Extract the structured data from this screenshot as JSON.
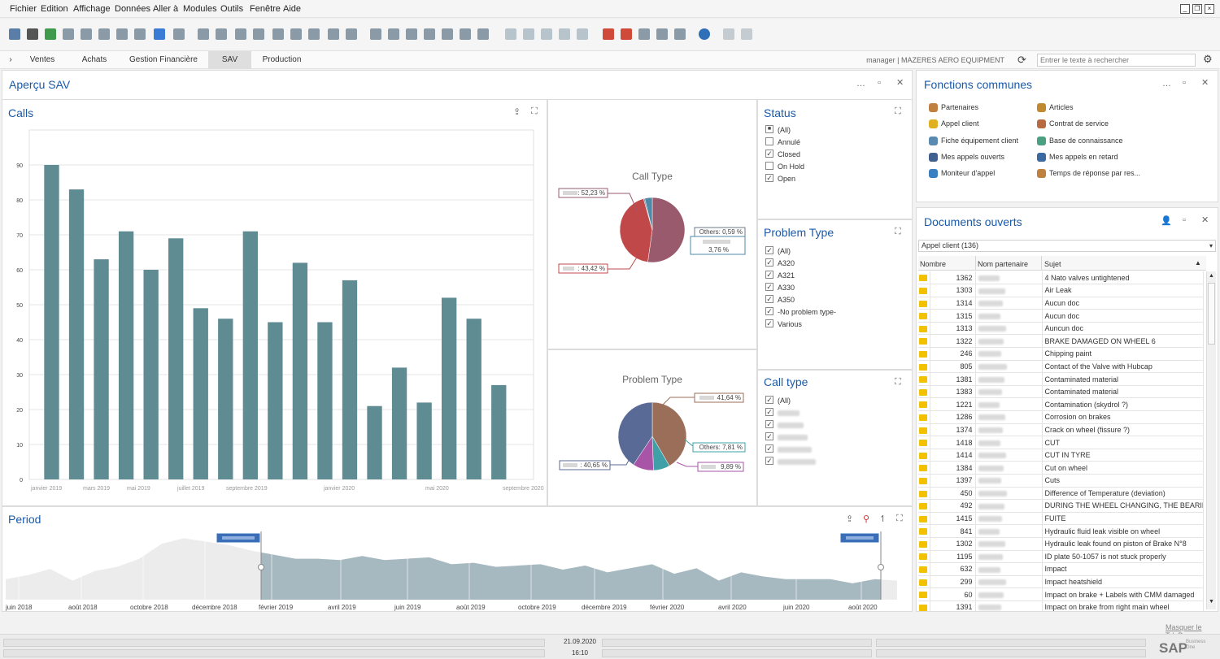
{
  "menu": [
    "Fichier",
    "Edition",
    "Affichage",
    "Données",
    "Aller à",
    "Modules",
    "Outils",
    "Fenêtre",
    "Aide"
  ],
  "modules": {
    "chevron": "›",
    "tabs": [
      "Ventes",
      "Achats",
      "Gestion Financière",
      "SAV",
      "Production"
    ],
    "active": "SAV"
  },
  "header": {
    "user": "manager | MAZERES AERO EQUIPMENT",
    "search_placeholder": "Entrer le texte à rechercher"
  },
  "overview": {
    "title": "Aperçu SAV"
  },
  "calls": {
    "title": "Calls"
  },
  "call_type_pie": {
    "title": "Call Type",
    "labels": [
      ": 52,23 %",
      ": 43,42 %",
      "Others: 0,59 %",
      "3,76 %"
    ]
  },
  "problem_type_pie": {
    "title": "Problem Type",
    "labels": [
      "41,64 %",
      "Others: 7,81 %",
      "9,89 %",
      ": 40,65 %"
    ]
  },
  "status": {
    "title": "Status",
    "items": [
      {
        "label": "(All)",
        "state": "partial"
      },
      {
        "label": "Annulé",
        "state": "off"
      },
      {
        "label": "Closed",
        "state": "on"
      },
      {
        "label": "On Hold",
        "state": "off"
      },
      {
        "label": "Open",
        "state": "on"
      }
    ]
  },
  "problem_type": {
    "title": "Problem Type",
    "items": [
      {
        "label": "(All)",
        "state": "on"
      },
      {
        "label": "A320",
        "state": "on"
      },
      {
        "label": "A321",
        "state": "on"
      },
      {
        "label": "A330",
        "state": "on"
      },
      {
        "label": "A350",
        "state": "on"
      },
      {
        "label": "-No problem type-",
        "state": "on"
      },
      {
        "label": "Various",
        "state": "on"
      }
    ]
  },
  "call_type": {
    "title": "Call type",
    "items": [
      {
        "label": "(All)",
        "state": "on"
      },
      {
        "label": "",
        "state": "on"
      },
      {
        "label": "",
        "state": "on"
      },
      {
        "label": "",
        "state": "on"
      },
      {
        "label": "",
        "state": "on"
      },
      {
        "label": "",
        "state": "on"
      }
    ]
  },
  "period": {
    "title": "Period",
    "ticks": [
      "juin 2018",
      "août 2018",
      "octobre 2018",
      "décembre 2018",
      "février 2019",
      "avril 2019",
      "juin 2019",
      "août 2019",
      "octobre 2019",
      "décembre 2019",
      "février 2020",
      "avril 2020",
      "juin 2020",
      "août 2020"
    ]
  },
  "fonctions": {
    "title": "Fonctions communes",
    "left": [
      "Partenaires",
      "Appel client",
      "Fiche équipement client",
      "Mes appels ouverts",
      "Moniteur d'appel"
    ],
    "right": [
      "Articles",
      "Contrat de service",
      "Base de connaissance",
      "Mes appels en retard",
      "Temps de réponse par res..."
    ]
  },
  "documents": {
    "title": "Documents ouverts",
    "selector": "Appel client (136)",
    "columns": [
      "Nombre",
      "Nom partenaire",
      "Sujet"
    ],
    "rows": [
      [
        "1362",
        "4 Nato valves untightened"
      ],
      [
        "1303",
        "Air Leak"
      ],
      [
        "1314",
        "Aucun doc"
      ],
      [
        "1315",
        "Aucun doc"
      ],
      [
        "1313",
        "Auncun doc"
      ],
      [
        "1322",
        "BRAKE DAMAGED ON WHEEL 6"
      ],
      [
        "246",
        "Chipping paint"
      ],
      [
        "805",
        "Contact of the Valve with Hubcap"
      ],
      [
        "1381",
        "Contaminated material"
      ],
      [
        "1383",
        "Contaminated material"
      ],
      [
        "1221",
        "Contamination (skydrol ?)"
      ],
      [
        "1286",
        "Corrosion on brakes"
      ],
      [
        "1374",
        "Crack on wheel (fissure ?)"
      ],
      [
        "1418",
        "CUT"
      ],
      [
        "1414",
        "CUT IN TYRE"
      ],
      [
        "1384",
        "Cut on wheel"
      ],
      [
        "1397",
        "Cuts"
      ],
      [
        "450",
        "Difference of Temperature (deviation)"
      ],
      [
        "492",
        "DURING THE WHEEL CHANGING, THE BEARING W..."
      ],
      [
        "1415",
        "FUITE"
      ],
      [
        "841",
        "Hydraulic fluid leak visible on wheel"
      ],
      [
        "1302",
        "Hydraulic leak found on piston of Brake N°8"
      ],
      [
        "1195",
        "ID plate 50-1057 is not stuck properly"
      ],
      [
        "632",
        "Impact"
      ],
      [
        "299",
        "Impact heatshield"
      ],
      [
        "60",
        "Impact on brake + Labels with CMM damaged"
      ],
      [
        "1391",
        "Impact on brake from right main wheel"
      ]
    ]
  },
  "status_bar": {
    "date": "21.09.2020",
    "time": "16:10",
    "link": "Masquer le TdeB",
    "brand": "SAP",
    "brand_sub": "Business One"
  },
  "chart_data": [
    {
      "type": "bar",
      "title": "Calls",
      "categories": [
        "janvier 2019",
        "",
        "mars 2019",
        "",
        "mai 2019",
        "",
        "juillet 2019",
        "",
        "septembre 2019",
        "",
        "",
        "",
        "janvier 2020",
        "",
        "",
        "",
        "mai 2020",
        "",
        "",
        "",
        "septembre 2020"
      ],
      "values": [
        90,
        83,
        63,
        71,
        60,
        69,
        49,
        46,
        71,
        45,
        62,
        45,
        57,
        21,
        32,
        22,
        52,
        46,
        27
      ],
      "ylim": [
        0,
        100
      ],
      "yticks": [
        0,
        10,
        20,
        30,
        40,
        50,
        60,
        70,
        80,
        90
      ]
    },
    {
      "type": "pie",
      "title": "Call Type",
      "values": [
        52.23,
        43.42,
        0.59,
        3.76
      ],
      "colors": [
        "#9a5a6e",
        "#c04848",
        "#6e7a8c",
        "#4e8aa8"
      ]
    },
    {
      "type": "pie",
      "title": "Problem Type",
      "values": [
        41.64,
        7.81,
        9.89,
        40.65
      ],
      "colors": [
        "#9b6e5a",
        "#3fa0a8",
        "#a855a8",
        "#5a6a96"
      ]
    },
    {
      "type": "area",
      "title": "Period",
      "x": [
        "juin 2018",
        "août 2018",
        "octobre 2018",
        "décembre 2018",
        "février 2019",
        "avril 2019",
        "juin 2019",
        "août 2019",
        "octobre 2019",
        "décembre 2019",
        "février 2020",
        "avril 2020",
        "juin 2020",
        "août 2020"
      ],
      "values": [
        38,
        30,
        22,
        40,
        85,
        72,
        62,
        58,
        52,
        58,
        45,
        32,
        40,
        32
      ]
    }
  ],
  "colors": {
    "bar": "#5f8b93",
    "accent": "#1a5aa8",
    "area_selected": "#a6b9c0",
    "area_unselected": "#ececec"
  }
}
